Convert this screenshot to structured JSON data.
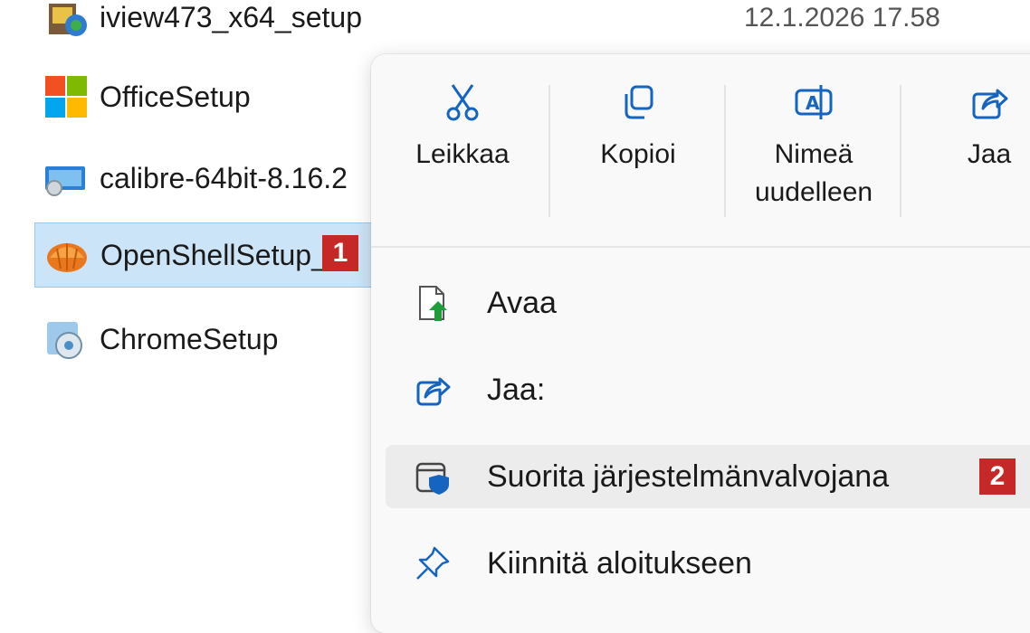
{
  "files": [
    {
      "name": "iview473_x64_setup",
      "date": "12.1.2026 17.58",
      "icon": "irfanview-icon"
    },
    {
      "name": "OfficeSetup",
      "icon": "office-icon"
    },
    {
      "name": "calibre-64bit-8.16.2",
      "icon": "calibre-icon"
    },
    {
      "name": "OpenShellSetup_",
      "icon": "openshell-icon",
      "selected": true
    },
    {
      "name": "ChromeSetup",
      "icon": "chrome-setup-icon"
    }
  ],
  "badges": {
    "first": "1",
    "second": "2"
  },
  "menu": {
    "actions": [
      {
        "label": "Leikkaa",
        "icon": "scissors-icon"
      },
      {
        "label": "Kopioi",
        "icon": "copy-icon"
      },
      {
        "label_line1": "Nimeä",
        "label_line2": "uudelleen",
        "icon": "rename-icon"
      },
      {
        "label": "Jaa",
        "icon": "share-icon"
      }
    ],
    "items": [
      {
        "label": "Avaa",
        "icon": "open-file-icon"
      },
      {
        "label": "Jaa:",
        "icon": "share-icon"
      },
      {
        "label": "Suorita järjestelmänvalvojana",
        "icon": "shield-window-icon",
        "highlighted": true
      },
      {
        "label": "Kiinnitä aloitukseen",
        "icon": "pin-icon"
      }
    ]
  },
  "colors": {
    "badge": "#c62828",
    "selection": "#cce4f7",
    "accent_blue": "#1565c0",
    "menu_background": "#f9f9f9"
  }
}
